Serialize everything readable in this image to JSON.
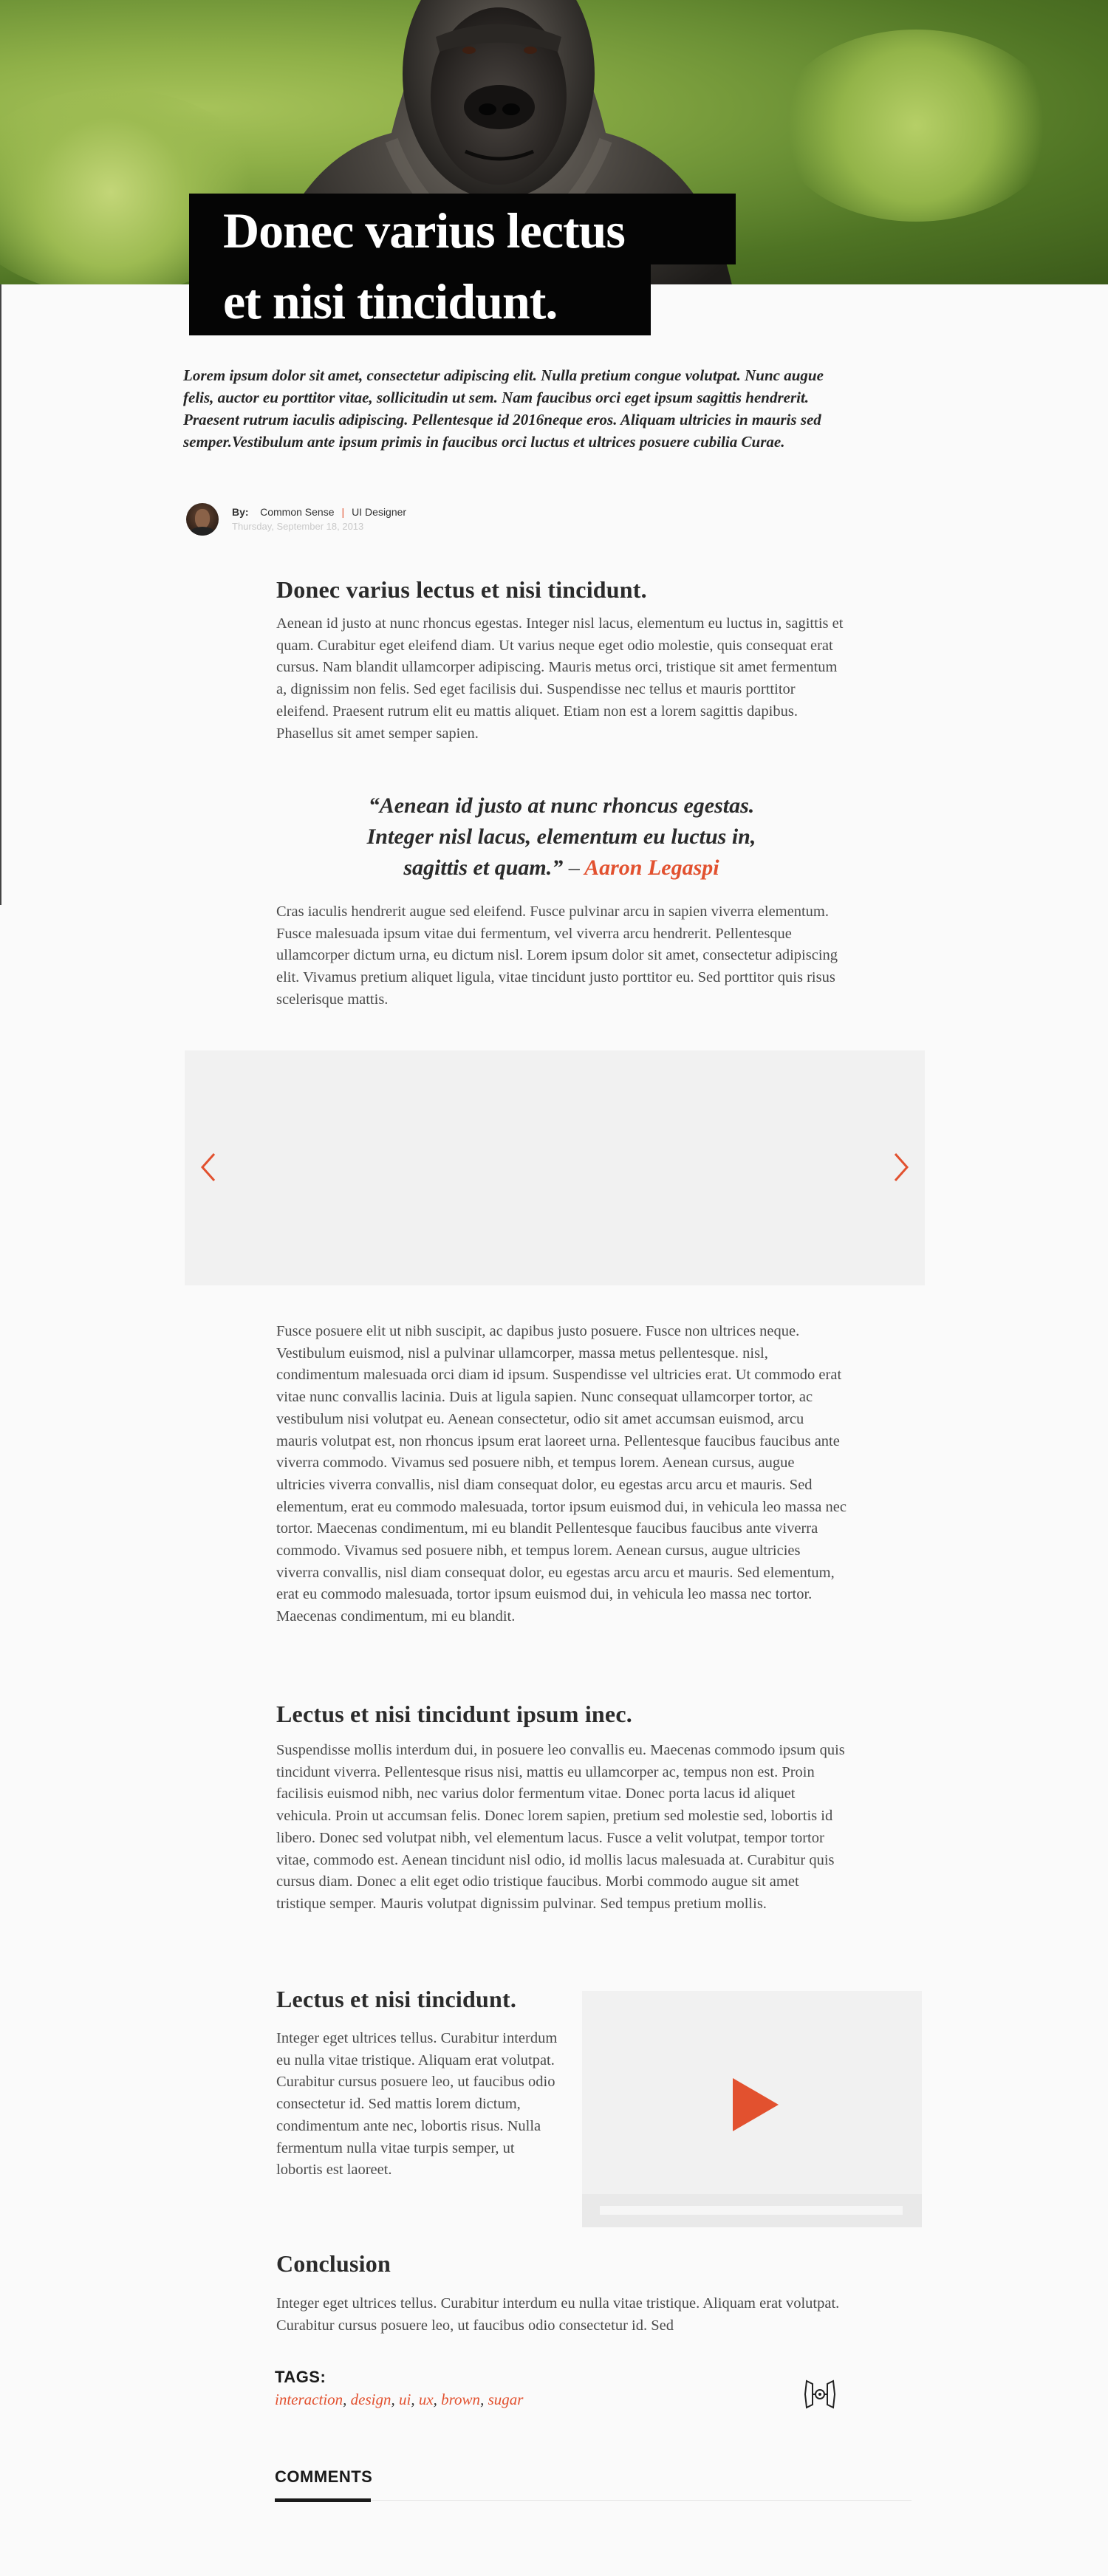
{
  "hero": {
    "title_line1": "Donec varius lectus",
    "title_line2": "et nisi tincidunt."
  },
  "lede": "Lorem ipsum dolor sit amet, consectetur adipiscing elit. Nulla pretium congue volutpat. Nunc augue felis, auctor eu porttitor vitae, sollicitudin ut sem. Nam faucibus orci eget ipsum sagittis hendrerit. Praesent rutrum iaculis adipiscing. Pellentesque id  2016neque eros. Aliquam ultricies in mauris sed semper.Vestibulum ante ipsum primis in faucibus orci luctus et ultrices posuere cubilia Curae.",
  "byline": {
    "by_label": "By:",
    "author": "Common Sense",
    "separator": "|",
    "role": "UI Designer",
    "date": "Thursday, September 18, 2013"
  },
  "section1": {
    "heading": "Donec varius lectus et nisi tincidunt.",
    "body": "Aenean id justo at nunc rhoncus egestas. Integer nisl lacus, elementum eu luctus in, sagittis et quam. Curabitur eget eleifend diam. Ut varius neque eget odio molestie, quis consequat erat cursus. Nam blandit ullamcorper adipiscing. Mauris metus orci, tristique sit amet fermentum a, dignissim non felis. Sed eget facilisis dui. Suspendisse nec tellus et mauris porttitor eleifend. Praesent rutrum elit eu mattis aliquet. Etiam non est a lorem sagittis dapibus. Phasellus sit amet semper sapien."
  },
  "quote": {
    "line1": "“Aenean id justo at nunc rhoncus egestas.",
    "line2": "Integer nisl lacus, elementum eu luctus in,",
    "line3": "sagittis et quam.”",
    "dash": "–",
    "author": "Aaron Legaspi"
  },
  "para2": "Cras iaculis hendrerit augue sed eleifend. Fusce pulvinar arcu in sapien viverra elementum. Fusce malesuada ipsum vitae dui fermentum, vel viverra arcu hendrerit. Pellentesque ullamcorper dictum urna, eu dictum nisl. Lorem ipsum dolor sit amet, consectetur adipiscing elit. Vivamus pretium aliquet ligula, vitae tincidunt justo porttitor eu. Sed porttitor quis risus scelerisque mattis.",
  "para3": "Fusce posuere elit ut nibh suscipit, ac dapibus justo posuere. Fusce non ultrices neque. Vestibulum euismod, nisl a pulvinar ullamcorper, massa metus pellentesque. nisl, condimentum malesuada orci diam id ipsum. Suspendisse vel ultricies erat. Ut commodo erat vitae nunc convallis lacinia. Duis at ligula sapien. Nunc consequat ullamcorper tortor, ac vestibulum nisi volutpat eu. Aenean consectetur, odio sit amet accumsan euismod, arcu mauris volutpat est, non rhoncus ipsum erat laoreet urna. Pellentesque faucibus faucibus ante viverra commodo. Vivamus sed posuere nibh, et tempus lorem. Aenean cursus, augue ultricies viverra convallis, nisl diam consequat dolor, eu egestas arcu arcu et mauris. Sed elementum, erat eu commodo malesuada, tortor ipsum euismod dui, in vehicula leo massa nec tortor. Maecenas condimentum, mi eu blandit Pellentesque faucibus faucibus ante viverra commodo. Vivamus sed posuere nibh, et tempus lorem. Aenean cursus, augue ultricies viverra convallis, nisl diam consequat dolor, eu egestas arcu arcu et mauris. Sed elementum, erat eu commodo malesuada, tortor ipsum euismod dui, in vehicula leo massa nec tortor. Maecenas condimentum, mi eu blandit.",
  "section2": {
    "heading": "Lectus et nisi tincidunt ipsum inec.",
    "body": "Suspendisse mollis interdum dui, in posuere leo convallis eu. Maecenas commodo ipsum quis tincidunt viverra. Pellentesque risus nisi, mattis eu ullamcorper ac, tempus non est. Proin facilisis euismod nibh, nec varius dolor fermentum vitae. Donec porta lacus id aliquet vehicula. Proin ut accumsan felis. Donec lorem sapien, pretium sed molestie sed, lobortis id libero. Donec sed volutpat nibh, vel elementum lacus. Fusce a velit volutpat, tempor tortor vitae, commodo est. Aenean tincidunt nisl odio, id mollis lacus malesuada at. Curabitur quis cursus diam. Donec a elit eget odio tristique faucibus. Morbi commodo augue sit amet tristique semper. Mauris volutpat dignissim pulvinar. Sed tempus pretium mollis."
  },
  "section3": {
    "heading": "Lectus et nisi tincidunt.",
    "body": "Integer eget ultrices tellus. Curabitur interdum eu nulla vitae tristique. Aliquam erat volutpat. Curabitur cursus posuere leo, ut faucibus odio consectetur id. Sed mattis lorem dictum, condimentum ante nec, lobortis risus. Nulla fermentum nulla vitae turpis semper, ut lobortis est laoreet."
  },
  "conclusion": {
    "heading": "Conclusion",
    "body": "Integer eget ultrices tellus. Curabitur interdum eu nulla vitae tristique. Aliquam erat volutpat. Curabitur cursus posuere leo, ut faucibus odio consectetur id. Sed"
  },
  "tags": {
    "label": "TAGS:",
    "items": [
      "interaction",
      "design",
      "ui",
      "ux",
      "brown",
      "sugar"
    ]
  },
  "comments": {
    "label": "COMMENTS"
  },
  "icons": {
    "slider_prev": "chevron-left-icon",
    "slider_next": "chevron-right-icon",
    "video_play": "play-icon",
    "brand_mark": "tie-fighter-icon"
  },
  "colors": {
    "accent": "#e2512f",
    "headline_bg": "#050505",
    "text": "#4a4a4a",
    "placeholder_bg": "#f1f1f1"
  }
}
